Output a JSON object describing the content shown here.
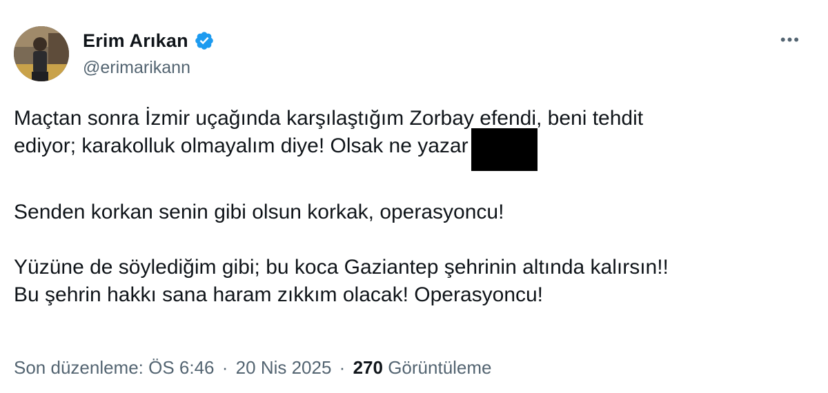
{
  "author": {
    "display_name": "Erim Arıkan",
    "handle": "@erimarikann",
    "verified": true
  },
  "icons": {
    "verified": "verified-badge-icon",
    "more": "more-options-icon"
  },
  "colors": {
    "verified_badge": "#1d9bf0",
    "secondary_text": "#536471",
    "primary_text": "#0f1419",
    "redaction": "#000000"
  },
  "tweet": {
    "line1": "Maçtan sonra İzmir uçağında karşılaştığım Zorbay efendi, beni tehdit",
    "line2": "ediyor; karakolluk olmayalım diye! Olsak ne yazar",
    "para2": "Senden korkan senin gibi olsun korkak, operasyoncu!",
    "para3_line1": "Yüzüne de söylediğim gibi; bu koca Gaziantep şehrinin altında kalırsın!!",
    "para3_line2": "Bu şehrin hakkı sana haram zıkkım olacak! Operasyoncu!"
  },
  "meta": {
    "edited_label": "Son düzenleme: ÖS 6:46",
    "separator": "·",
    "date": "20 Nis 2025",
    "views_count": "270",
    "views_label": "Görüntüleme"
  }
}
